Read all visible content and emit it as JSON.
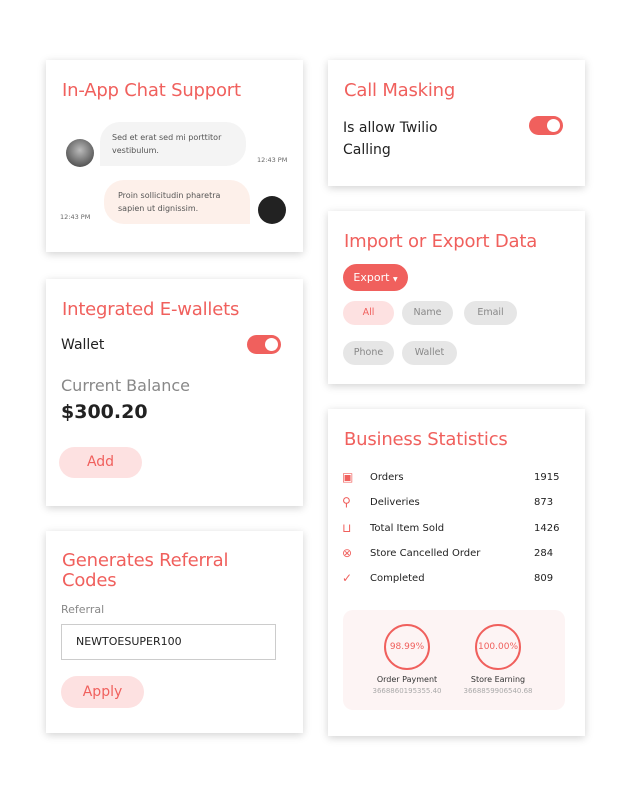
{
  "chat": {
    "title": "In-App Chat Support",
    "msg1": "Sed et erat sed mi porttitor vestibulum.",
    "time1": "12:43 PM",
    "msg2": "Proin sollicitudin pharetra sapien ut dignissim.",
    "time2": "12:43 PM"
  },
  "wallet": {
    "title": "Integrated E-wallets",
    "toggle_label": "Wallet",
    "toggle_on": true,
    "balance_label": "Current Balance",
    "balance": "$300.20",
    "add": "Add"
  },
  "referral": {
    "title": "Generates Referral Codes",
    "label": "Referral",
    "value": "NEWTOESUPER100",
    "apply": "Apply"
  },
  "call": {
    "title": "Call Masking",
    "toggle_label": "Is allow Twilio Calling",
    "toggle_on": true
  },
  "import": {
    "title": "Import or Export Data",
    "export": "Export",
    "filters": [
      "All",
      "Name",
      "Email",
      "Phone",
      "Wallet"
    ],
    "active_filter": "All"
  },
  "stats": {
    "title": "Business Statistics",
    "items": [
      {
        "icon": "bag-icon",
        "label": "Orders",
        "value": "1915"
      },
      {
        "icon": "delivery-icon",
        "label": "Deliveries",
        "value": "873"
      },
      {
        "icon": "basket-icon",
        "label": "Total Item Sold",
        "value": "1426"
      },
      {
        "icon": "cancel-circle-icon",
        "label": "Store Cancelled Order",
        "value": "284"
      },
      {
        "icon": "check-circle-icon",
        "label": "Completed",
        "value": "809"
      }
    ],
    "rings": [
      {
        "pct": "98.99%",
        "label": "Order Payment",
        "amount": "3668860195355.40"
      },
      {
        "pct": "100.00%",
        "label": "Store Earning",
        "amount": "3668859906540.68"
      }
    ]
  },
  "colors": {
    "accent": "#f0605d",
    "pill_active": "#fde1e1",
    "bubble_in": "#f4f4f4",
    "bubble_out": "#fdf0ea"
  }
}
